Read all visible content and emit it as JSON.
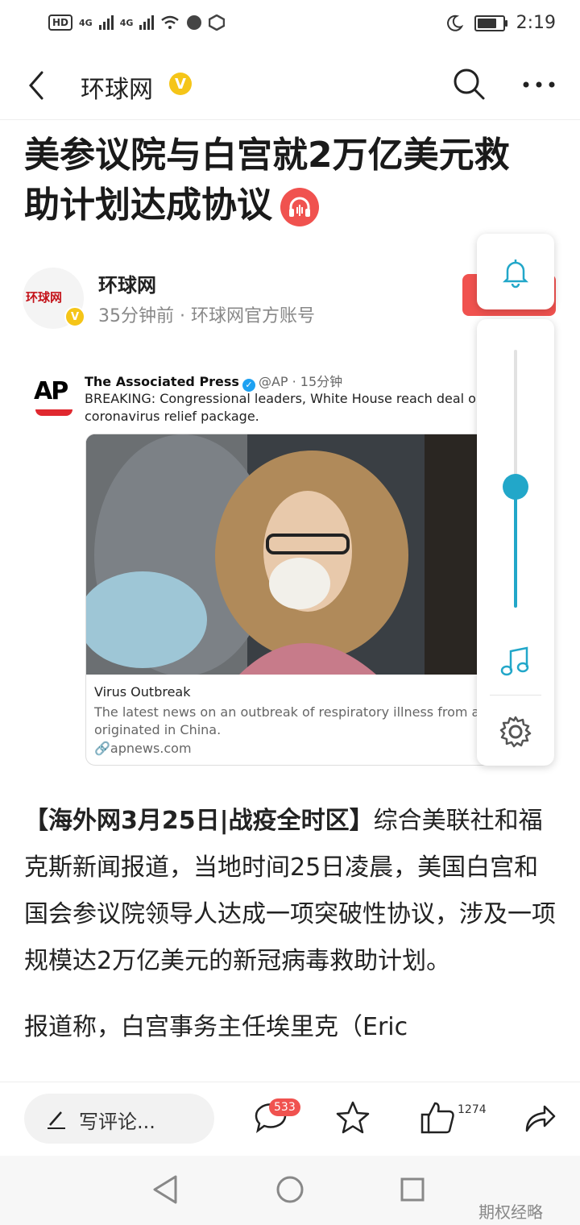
{
  "status_bar": {
    "hd_label": "HD",
    "net1": "4G",
    "net2": "4G",
    "time": "2:19"
  },
  "nav": {
    "title": "环球网",
    "verified_mark": "V"
  },
  "headline": {
    "text": "美参议院与白宫就2万亿美元救助计划达成协议"
  },
  "author": {
    "name": "环球网",
    "meta": "35分钟前 · 环球网官方账号",
    "avatar_text": "环球网",
    "verified_mark": "V"
  },
  "tweet": {
    "logo": "AP",
    "name": "The Associated Press",
    "handle": "@AP · 15分钟",
    "text": "BREAKING: Congressional leaders, White House reach deal o coronavirus relief package.",
    "card_title": "Virus Outbreak",
    "card_desc": "The latest news on an outbreak of respiratory illness from a that originated in China.",
    "card_link": "apnews.com"
  },
  "float_panel": {
    "slider_level": 0.47
  },
  "article": {
    "p1_bold": "【海外网3月25日|战疫全时区】",
    "p1_rest": "综合美联社和福克斯新闻报道，当地时间25日凌晨，美国白宫和国会参议院领导人达成一项突破性协议，涉及一项规模达2万亿美元的新冠病毒救助计划。",
    "p2": "报道称，白宫事务主任埃里克（Eric"
  },
  "toolbar": {
    "comment_placeholder": "写评论...",
    "comment_count": "533",
    "like_count": "1274"
  },
  "watermark": "期权经略",
  "colors": {
    "accent_red": "#f0524f",
    "teal": "#22a7c9",
    "verified_gold": "#f5c518"
  }
}
